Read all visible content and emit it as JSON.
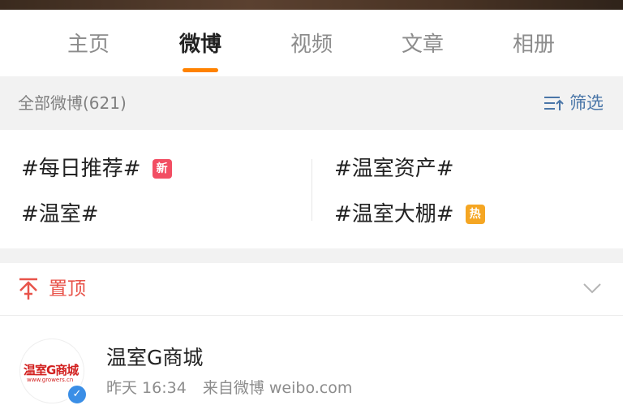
{
  "tabs": [
    {
      "label": "主页"
    },
    {
      "label": "微博"
    },
    {
      "label": "视频"
    },
    {
      "label": "文章"
    },
    {
      "label": "相册"
    }
  ],
  "active_tab": "微博",
  "accent_color": "#ff8200",
  "filter_bar": {
    "count_label": "全部微博(621)",
    "filter_label": "筛选"
  },
  "topics": [
    {
      "label": "#每日推荐#",
      "badge": "新"
    },
    {
      "label": "#温室资产#",
      "badge": ""
    },
    {
      "label": "#温室#",
      "badge": ""
    },
    {
      "label": "#温室大棚#",
      "badge": "热"
    }
  ],
  "pinned": {
    "label": "置顶"
  },
  "post": {
    "avatar_text": "温室G商城",
    "avatar_url": "www.growers.cn",
    "author": "温室G商城",
    "time": "昨天 16:34",
    "source": "来自微博 weibo.com",
    "verified_icon": "verified-badge-icon"
  }
}
